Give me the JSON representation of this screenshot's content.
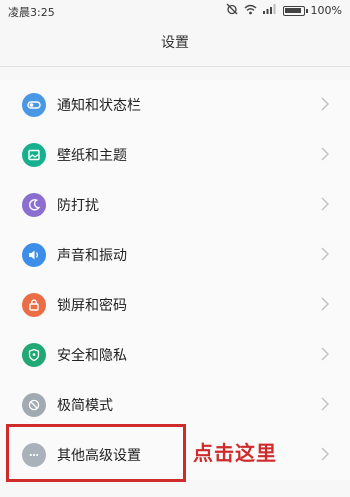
{
  "status_bar": {
    "time": "凌晨3:25",
    "battery": "100%",
    "battery_level": 1.0,
    "icons": [
      "alarm-off-icon",
      "wifi-icon",
      "signal-icon",
      "battery-icon"
    ]
  },
  "header": {
    "title": "设置"
  },
  "menu": {
    "items": [
      {
        "label": "通知和状态栏",
        "icon": "toggle-icon",
        "color": "#4a97e4"
      },
      {
        "label": "壁纸和主题",
        "icon": "picture-icon",
        "color": "#17b08f"
      },
      {
        "label": "防打扰",
        "icon": "moon-icon",
        "color": "#8a6fd0"
      },
      {
        "label": "声音和振动",
        "icon": "speaker-icon",
        "color": "#3d8ee8"
      },
      {
        "label": "锁屏和密码",
        "icon": "lock-icon",
        "color": "#ea6d46"
      },
      {
        "label": "安全和隐私",
        "icon": "shield-icon",
        "color": "#21a874"
      },
      {
        "label": "极简模式",
        "icon": "compass-icon",
        "color": "#a1a9b3"
      },
      {
        "label": "其他高级设置",
        "icon": "more-icon",
        "color": "#a9b1bb"
      }
    ]
  },
  "annotation": {
    "text": "点击这里",
    "color": "#d02b2b"
  }
}
